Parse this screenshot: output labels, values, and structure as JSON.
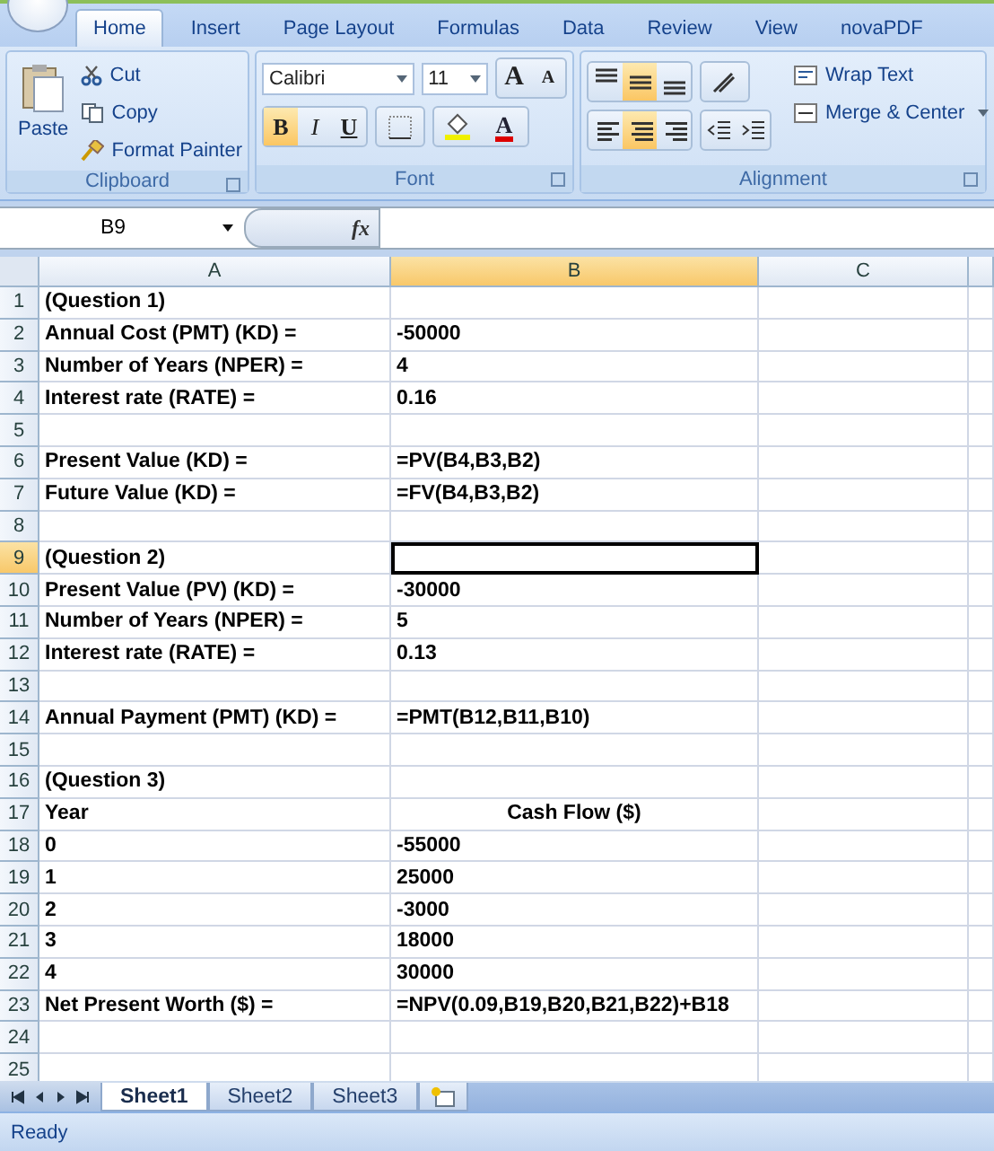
{
  "ribbon_tabs": [
    {
      "label": "Home",
      "selected": true
    },
    {
      "label": "Insert",
      "selected": false
    },
    {
      "label": "Page Layout",
      "selected": false
    },
    {
      "label": "Formulas",
      "selected": false
    },
    {
      "label": "Data",
      "selected": false
    },
    {
      "label": "Review",
      "selected": false
    },
    {
      "label": "View",
      "selected": false
    },
    {
      "label": "novaPDF",
      "selected": false
    }
  ],
  "clipboard": {
    "title": "Clipboard",
    "paste": "Paste",
    "cut": "Cut",
    "copy": "Copy",
    "format_painter": "Format Painter"
  },
  "font": {
    "title": "Font",
    "name": "Calibri",
    "size": "11",
    "grow": "A",
    "shrink": "A",
    "bold": {
      "label": "B",
      "selected": true
    },
    "italic": {
      "label": "I",
      "selected": false
    },
    "underline": {
      "label": "U",
      "selected": false
    },
    "color_letter": "A"
  },
  "alignment": {
    "title": "Alignment",
    "vertical": [
      {
        "kind": "top",
        "selected": false
      },
      {
        "kind": "middle",
        "selected": true
      },
      {
        "kind": "bottom",
        "selected": false
      }
    ],
    "horizontal": [
      {
        "kind": "left",
        "selected": false
      },
      {
        "kind": "center",
        "selected": true
      },
      {
        "kind": "right",
        "selected": false
      }
    ],
    "wrap_text": "Wrap Text",
    "merge_center": "Merge & Center"
  },
  "name_box": "B9",
  "fx": "fx",
  "columns": [
    {
      "label": "A",
      "selected": false
    },
    {
      "label": "B",
      "selected": true
    },
    {
      "label": "C",
      "selected": false
    }
  ],
  "rows": [
    {
      "header": "1",
      "selected": false,
      "cells": [
        {
          "text": "(Question 1)"
        },
        {}
      ]
    },
    {
      "header": "2",
      "selected": false,
      "cells": [
        {
          "text": "Annual Cost (PMT) (KD) ="
        },
        {
          "text": "-50000"
        }
      ]
    },
    {
      "header": "3",
      "selected": false,
      "cells": [
        {
          "text": "Number of Years (NPER) ="
        },
        {
          "text": "4"
        }
      ]
    },
    {
      "header": "4",
      "selected": false,
      "cells": [
        {
          "text": "Interest rate (RATE) ="
        },
        {
          "text": "0.16"
        }
      ]
    },
    {
      "header": "5",
      "selected": false,
      "cells": [
        {},
        {}
      ]
    },
    {
      "header": "6",
      "selected": false,
      "cells": [
        {
          "text": "Present Value (KD) ="
        },
        {
          "text": "=PV(B4,B3,B2)"
        }
      ]
    },
    {
      "header": "7",
      "selected": false,
      "cells": [
        {
          "text": "Future Value (KD) ="
        },
        {
          "text": "=FV(B4,B3,B2)"
        }
      ]
    },
    {
      "header": "8",
      "selected": false,
      "cells": [
        {},
        {}
      ]
    },
    {
      "header": "9",
      "selected": true,
      "cells": [
        {
          "text": "(Question 2)"
        },
        {
          "selected": true
        }
      ]
    },
    {
      "header": "10",
      "selected": false,
      "cells": [
        {
          "text": "Present Value (PV) (KD) ="
        },
        {
          "text": "-30000"
        }
      ]
    },
    {
      "header": "11",
      "selected": false,
      "cells": [
        {
          "text": "Number of Years (NPER) ="
        },
        {
          "text": "5"
        }
      ]
    },
    {
      "header": "12",
      "selected": false,
      "cells": [
        {
          "text": "Interest rate (RATE) ="
        },
        {
          "text": "0.13"
        }
      ]
    },
    {
      "header": "13",
      "selected": false,
      "cells": [
        {},
        {}
      ]
    },
    {
      "header": "14",
      "selected": false,
      "cells": [
        {
          "text": "Annual Payment (PMT) (KD) ="
        },
        {
          "text": "=PMT(B12,B11,B10)"
        }
      ]
    },
    {
      "header": "15",
      "selected": false,
      "cells": [
        {},
        {}
      ]
    },
    {
      "header": "16",
      "selected": false,
      "cells": [
        {
          "text": "(Question 3)"
        },
        {}
      ]
    },
    {
      "header": "17",
      "selected": false,
      "cells": [
        {
          "text": "Year"
        },
        {
          "text": "Cash Flow ($)",
          "centered": true
        }
      ]
    },
    {
      "header": "18",
      "selected": false,
      "cells": [
        {
          "text": "0"
        },
        {
          "text": "-55000"
        }
      ]
    },
    {
      "header": "19",
      "selected": false,
      "cells": [
        {
          "text": "1"
        },
        {
          "text": "25000"
        }
      ]
    },
    {
      "header": "20",
      "selected": false,
      "cells": [
        {
          "text": "2"
        },
        {
          "text": "-3000"
        }
      ]
    },
    {
      "header": "21",
      "selected": false,
      "cells": [
        {
          "text": "3"
        },
        {
          "text": "18000"
        }
      ]
    },
    {
      "header": "22",
      "selected": false,
      "cells": [
        {
          "text": "4"
        },
        {
          "text": "30000"
        }
      ]
    },
    {
      "header": "23",
      "selected": false,
      "cells": [
        {
          "text": "Net Present Worth ($) ="
        },
        {
          "text": "=NPV(0.09,B19,B20,B21,B22)+B18"
        }
      ]
    },
    {
      "header": "24",
      "selected": false,
      "cells": [
        {},
        {}
      ]
    },
    {
      "header": "25",
      "selected": false,
      "cells": [
        {},
        {}
      ]
    }
  ],
  "sheet_tabs": [
    {
      "label": "Sheet1",
      "selected": true
    },
    {
      "label": "Sheet2",
      "selected": false
    },
    {
      "label": "Sheet3",
      "selected": false
    }
  ],
  "status": "Ready"
}
